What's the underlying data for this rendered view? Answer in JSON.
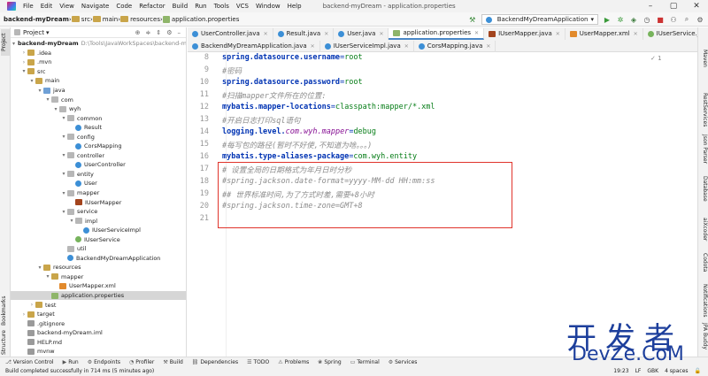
{
  "menu": [
    "File",
    "Edit",
    "View",
    "Navigate",
    "Code",
    "Refactor",
    "Build",
    "Run",
    "Tools",
    "VCS",
    "Window",
    "Help"
  ],
  "window_title": "backend-myDream - application.properties",
  "breadcrumb": [
    "backend-myDream",
    "src",
    "main",
    "resources",
    "application.properties"
  ],
  "run_config": "BackendMyDreamApplication",
  "project_panel": {
    "title": "Project",
    "tree": [
      {
        "label": "backend-myDream",
        "extra": "D:\\Tools\\JavaWorkSpaces\\backend-m",
        "icon": "folder",
        "arrow": "▾",
        "indent": 0,
        "bold": true
      },
      {
        "label": ".idea",
        "icon": "folder",
        "arrow": "›",
        "indent": 1
      },
      {
        "label": ".mvn",
        "icon": "folder",
        "arrow": "›",
        "indent": 1
      },
      {
        "label": "src",
        "icon": "folder",
        "arrow": "▾",
        "indent": 1
      },
      {
        "label": "main",
        "icon": "folder",
        "arrow": "▾",
        "indent": 2
      },
      {
        "label": "java",
        "icon": "srcfolder",
        "arrow": "▾",
        "indent": 3
      },
      {
        "label": "com",
        "icon": "pkg",
        "arrow": "▾",
        "indent": 4
      },
      {
        "label": "wyh",
        "icon": "pkg",
        "arrow": "▾",
        "indent": 5
      },
      {
        "label": "common",
        "icon": "pkg",
        "arrow": "▾",
        "indent": 6
      },
      {
        "label": "Result",
        "icon": "cls",
        "arrow": "",
        "indent": 7
      },
      {
        "label": "config",
        "icon": "pkg",
        "arrow": "▾",
        "indent": 6
      },
      {
        "label": "CorsMapping",
        "icon": "cls",
        "arrow": "",
        "indent": 7
      },
      {
        "label": "controller",
        "icon": "pkg",
        "arrow": "▾",
        "indent": 6
      },
      {
        "label": "UserController",
        "icon": "cls",
        "arrow": "",
        "indent": 7
      },
      {
        "label": "entity",
        "icon": "pkg",
        "arrow": "▾",
        "indent": 6
      },
      {
        "label": "User",
        "icon": "cls",
        "arrow": "",
        "indent": 7
      },
      {
        "label": "mapper",
        "icon": "pkg",
        "arrow": "▾",
        "indent": 6
      },
      {
        "label": "IUserMapper",
        "icon": "mapper",
        "arrow": "",
        "indent": 7
      },
      {
        "label": "service",
        "icon": "pkg",
        "arrow": "▾",
        "indent": 6
      },
      {
        "label": "impl",
        "icon": "pkg",
        "arrow": "▾",
        "indent": 7
      },
      {
        "label": "IUserServiceImpl",
        "icon": "cls",
        "arrow": "",
        "indent": 8
      },
      {
        "label": "IUserService",
        "icon": "iface",
        "arrow": "",
        "indent": 7
      },
      {
        "label": "util",
        "icon": "pkg",
        "arrow": "",
        "indent": 6
      },
      {
        "label": "BackendMyDreamApplication",
        "icon": "cls",
        "arrow": "",
        "indent": 6
      },
      {
        "label": "resources",
        "icon": "folder",
        "arrow": "▾",
        "indent": 3
      },
      {
        "label": "mapper",
        "icon": "folder",
        "arrow": "▾",
        "indent": 4
      },
      {
        "label": "UserMapper.xml",
        "icon": "xml",
        "arrow": "",
        "indent": 5
      },
      {
        "label": "application.properties",
        "icon": "props",
        "arrow": "",
        "indent": 4,
        "selected": true
      },
      {
        "label": "test",
        "icon": "folder",
        "arrow": "›",
        "indent": 2
      },
      {
        "label": "target",
        "icon": "folder",
        "arrow": "›",
        "indent": 1
      },
      {
        "label": ".gitignore",
        "icon": "file",
        "arrow": "",
        "indent": 1
      },
      {
        "label": "backend-myDream.iml",
        "icon": "file",
        "arrow": "",
        "indent": 1
      },
      {
        "label": "HELP.md",
        "icon": "file",
        "arrow": "",
        "indent": 1
      },
      {
        "label": "mvnw",
        "icon": "file",
        "arrow": "",
        "indent": 1
      }
    ]
  },
  "tabs_row1": [
    {
      "label": "UserController.java",
      "icon": "cls"
    },
    {
      "label": "Result.java",
      "icon": "cls"
    },
    {
      "label": "User.java",
      "icon": "cls"
    },
    {
      "label": "application.properties",
      "icon": "props",
      "active": true
    },
    {
      "label": "IUserMapper.java",
      "icon": "mapper"
    },
    {
      "label": "UserMapper.xml",
      "icon": "xml"
    },
    {
      "label": "IUserService.java",
      "icon": "iface"
    }
  ],
  "tabs_row2": [
    {
      "label": "BackendMyDreamApplication.java",
      "icon": "cls"
    },
    {
      "label": "IUserServiceImpl.java",
      "icon": "cls"
    },
    {
      "label": "CorsMapping.java",
      "icon": "cls"
    }
  ],
  "editor": {
    "inspections": "✓ 1",
    "lines": [
      {
        "n": "8",
        "parts": [
          [
            "k",
            "spring.datasource.username"
          ],
          [
            "eq",
            "="
          ],
          [
            "v",
            "root"
          ]
        ]
      },
      {
        "n": "9",
        "parts": [
          [
            "c",
            "#密码"
          ]
        ]
      },
      {
        "n": "10",
        "parts": [
          [
            "k",
            "spring.datasource.password"
          ],
          [
            "eq",
            "="
          ],
          [
            "v",
            "root"
          ]
        ]
      },
      {
        "n": "11",
        "parts": [
          [
            "c",
            "#扫描mapper文件所在的位置:"
          ]
        ]
      },
      {
        "n": "12",
        "parts": [
          [
            "k",
            "mybatis.mapper-locations"
          ],
          [
            "eq",
            "="
          ],
          [
            "v",
            "classpath:mapper/*.xml"
          ]
        ]
      },
      {
        "n": "13",
        "parts": [
          [
            "c",
            "#开启日志打印sql语句"
          ]
        ]
      },
      {
        "n": "14",
        "parts": [
          [
            "k",
            "logging.level."
          ],
          [
            "i",
            "com.wyh.mapper"
          ],
          [
            "eq",
            "="
          ],
          [
            "v",
            "debug"
          ]
        ]
      },
      {
        "n": "15",
        "parts": [
          [
            "c",
            "#每写包的路径(暂时不好使,不知道为啥。。。)"
          ]
        ]
      },
      {
        "n": "16",
        "parts": [
          [
            "k",
            "mybatis.type-aliases-package"
          ],
          [
            "eq",
            "="
          ],
          [
            "v",
            "com.wyh.entity"
          ]
        ]
      },
      {
        "n": "17",
        "parts": [
          [
            "c",
            "# 设置全局的日期格式为年月日时分秒"
          ]
        ]
      },
      {
        "n": "18",
        "parts": [
          [
            "c",
            "#spring.jackson.date-format=yyyy-MM-dd HH:mm:ss"
          ]
        ]
      },
      {
        "n": "19",
        "parts": [
          [
            "c",
            "## 世界标准时间,为了方式时差,需要+8小时"
          ]
        ]
      },
      {
        "n": "20",
        "parts": [
          [
            "c",
            "#spring.jackson.time-zone=GMT+8"
          ]
        ]
      },
      {
        "n": "21",
        "parts": []
      }
    ]
  },
  "right_stripe": [
    "Maven",
    "RestServices",
    "Json Parser",
    "Database",
    "aiXcoder",
    "Codota",
    "Notifications",
    "JPA Buddy"
  ],
  "left_stripe": [
    "Project",
    "Bookmarks",
    "Structure"
  ],
  "tool_windows": [
    {
      "label": "Version Control",
      "icon": "⎇"
    },
    {
      "label": "Run",
      "icon": "▶"
    },
    {
      "label": "Endpoints",
      "icon": "⚙"
    },
    {
      "label": "Profiler",
      "icon": "◔"
    },
    {
      "label": "Build",
      "icon": "⚒"
    },
    {
      "label": "Dependencies",
      "icon": "⛓"
    },
    {
      "label": "TODO",
      "icon": "☰"
    },
    {
      "label": "Problems",
      "icon": "⚠"
    },
    {
      "label": "Spring",
      "icon": "❀"
    },
    {
      "label": "Terminal",
      "icon": "▭"
    },
    {
      "label": "Services",
      "icon": "⚙"
    }
  ],
  "status": {
    "message": "Build completed successfully in 714 ms (5 minutes ago)",
    "position": "19:23",
    "line_sep": "LF",
    "encoding": "GBK",
    "indent": "4 spaces"
  },
  "watermark": {
    "cn": "开发者",
    "en": "DevZe.CoM"
  }
}
